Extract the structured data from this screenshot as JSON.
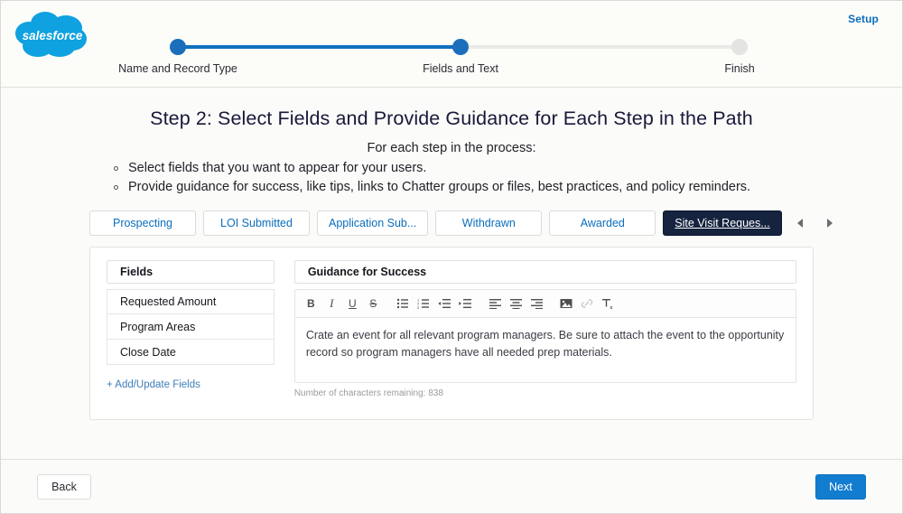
{
  "header": {
    "logo_alt": "salesforce",
    "logo_wordmark": "salesforce",
    "setup_link": "Setup",
    "brand_color": "#00A1E0",
    "accent_color": "#0F70BC",
    "progress": {
      "steps": [
        {
          "label": "Name and Record Type",
          "state": "done"
        },
        {
          "label": "Fields and Text",
          "state": "current"
        },
        {
          "label": "Finish",
          "state": "todo"
        }
      ]
    }
  },
  "main": {
    "step_title": "Step 2: Select Fields and Provide Guidance for Each Step in the Path",
    "intro": "For each step in the process:",
    "bullets": [
      "Select fields that you want to appear for your users.",
      "Provide guidance for success, like tips, links to Chatter groups or files, best practices, and policy reminders."
    ],
    "tabs": [
      {
        "label": "Prospecting",
        "active": false
      },
      {
        "label": "LOI Submitted",
        "active": false
      },
      {
        "label": "Application Sub...",
        "active": false
      },
      {
        "label": "Withdrawn",
        "active": false
      },
      {
        "label": "Awarded",
        "active": false
      },
      {
        "label": "Site Visit Reques...",
        "active": true
      }
    ],
    "tab_nav": {
      "prev_icon": "caret-left-icon",
      "next_icon": "caret-right-icon"
    },
    "fields_panel": {
      "header": "Fields",
      "rows": [
        "Requested Amount",
        "Program Areas",
        "Close Date"
      ],
      "add_link": "+ Add/Update Fields"
    },
    "guidance_panel": {
      "header": "Guidance for Success",
      "toolbar": [
        {
          "name": "bold-icon",
          "glyph": "B",
          "disabled": false
        },
        {
          "name": "italic-icon",
          "glyph": "I",
          "disabled": false
        },
        {
          "name": "underline-icon",
          "glyph": "U",
          "disabled": false
        },
        {
          "name": "strikethrough-icon",
          "glyph": "S",
          "disabled": false
        },
        {
          "name": "bulleted-list-icon",
          "glyph": "",
          "disabled": false
        },
        {
          "name": "numbered-list-icon",
          "glyph": "",
          "disabled": false
        },
        {
          "name": "indent-decrease-icon",
          "glyph": "",
          "disabled": false
        },
        {
          "name": "indent-increase-icon",
          "glyph": "",
          "disabled": false
        },
        {
          "name": "align-left-icon",
          "glyph": "",
          "disabled": false
        },
        {
          "name": "align-center-icon",
          "glyph": "",
          "disabled": false
        },
        {
          "name": "align-right-icon",
          "glyph": "",
          "disabled": false
        },
        {
          "name": "image-icon",
          "glyph": "",
          "disabled": false
        },
        {
          "name": "link-icon",
          "glyph": "",
          "disabled": true
        },
        {
          "name": "remove-formatting-icon",
          "glyph": "",
          "disabled": false
        }
      ],
      "body_text": "Crate an event for all relevant program managers. Be sure to attach the event to the opportunity record so program managers have all needed prep materials.",
      "char_count": "Number of characters remaining: 838"
    }
  },
  "footer": {
    "back_label": "Back",
    "next_label": "Next"
  }
}
